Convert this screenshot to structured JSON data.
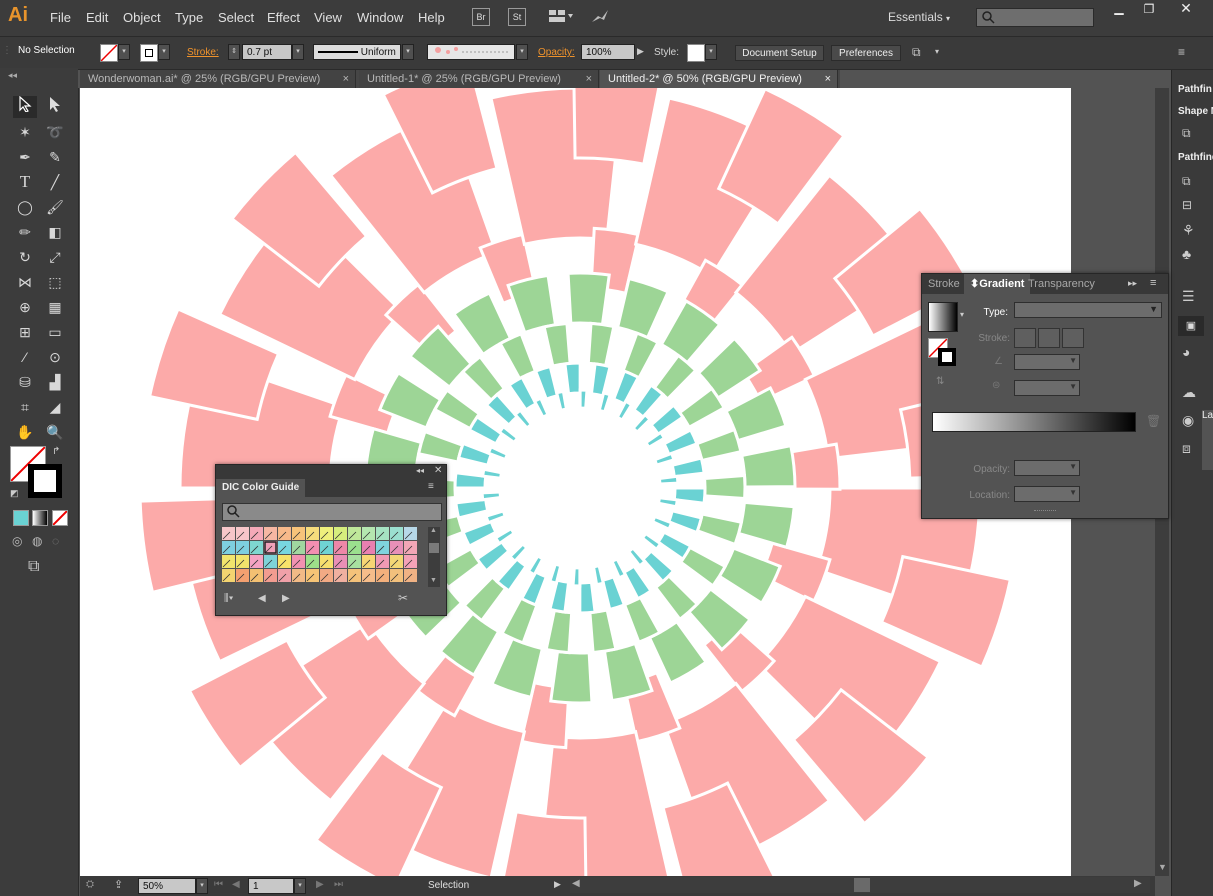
{
  "app": {
    "logo": "Ai"
  },
  "menu": [
    "File",
    "Edit",
    "Object",
    "Type",
    "Select",
    "Effect",
    "View",
    "Window",
    "Help"
  ],
  "menu_icons": {
    "bridge": "Br",
    "stock": "St"
  },
  "workspace": {
    "label": "Essentials"
  },
  "control": {
    "selection": "No Selection",
    "stroke_label": "Stroke:",
    "stroke_value": "0.7 pt",
    "stroke_profile": "Uniform",
    "opacity_label": "Opacity:",
    "opacity_value": "100%",
    "style_label": "Style:",
    "document_setup": "Document Setup",
    "preferences": "Preferences"
  },
  "tabs": [
    {
      "label": "Wonderwoman.ai* @ 25% (RGB/GPU Preview)",
      "close": "×"
    },
    {
      "label": "Untitled-1* @ 25% (RGB/GPU Preview)",
      "close": "×"
    },
    {
      "label": "Untitled-2* @ 50% (RGB/GPU Preview)",
      "close": "×"
    }
  ],
  "gradient_panel": {
    "tabs": [
      "Stroke",
      "Gradient",
      "Transparency"
    ],
    "type_label": "Type:",
    "stroke_label": "Stroke:",
    "opacity_label": "Opacity:",
    "location_label": "Location:"
  },
  "color_guide": {
    "title": "DIC Color Guide"
  },
  "dock": {
    "pathfinder": "Pathfin",
    "shape": "Shape M",
    "pathfinder2": "Pathfind",
    "layers": "La"
  },
  "status": {
    "zoom": "50%",
    "page": "1",
    "mode": "Selection"
  },
  "colors": {
    "pink": "#fcaaa9",
    "green": "#9dd596",
    "teal": "#6ad2d3",
    "accent": "#e8942c"
  }
}
